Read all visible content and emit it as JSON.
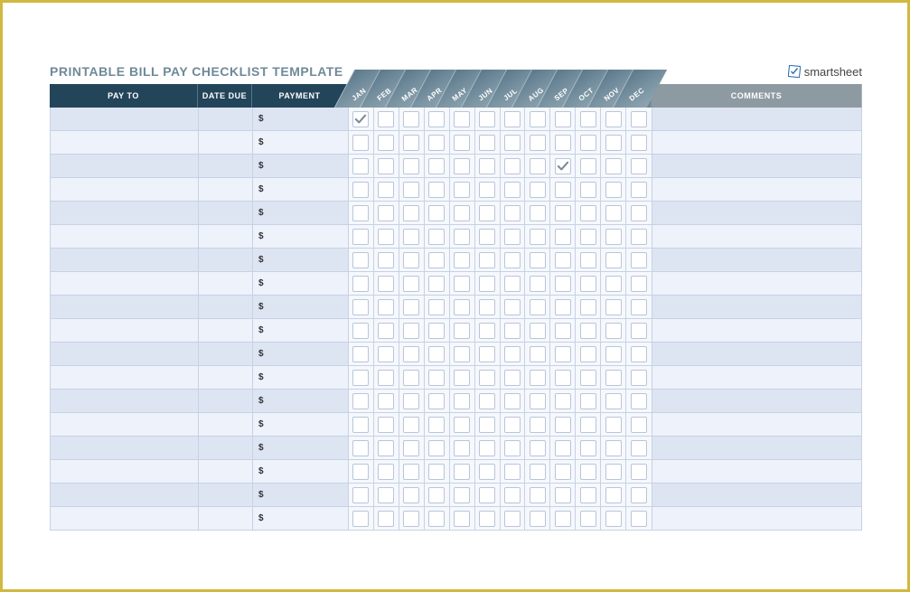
{
  "title": "PRINTABLE BILL PAY CHECKLIST TEMPLATE",
  "brand": "smartsheet",
  "headers": {
    "pay_to": "PAY TO",
    "date_due": "DATE DUE",
    "payment": "PAYMENT",
    "comments": "COMMENTS"
  },
  "months": [
    "JAN",
    "FEB",
    "MAR",
    "APR",
    "MAY",
    "JUN",
    "JUL",
    "AUG",
    "SEP",
    "OCT",
    "NOV",
    "DEC"
  ],
  "currency_symbol": "$",
  "rows": [
    {
      "pay_to": "",
      "date_due": "",
      "payment": "",
      "comments": "",
      "checks": [
        true,
        false,
        false,
        false,
        false,
        false,
        false,
        false,
        false,
        false,
        false,
        false
      ]
    },
    {
      "pay_to": "",
      "date_due": "",
      "payment": "",
      "comments": "",
      "checks": [
        false,
        false,
        false,
        false,
        false,
        false,
        false,
        false,
        false,
        false,
        false,
        false
      ]
    },
    {
      "pay_to": "",
      "date_due": "",
      "payment": "",
      "comments": "",
      "checks": [
        false,
        false,
        false,
        false,
        false,
        false,
        false,
        false,
        true,
        false,
        false,
        false
      ]
    },
    {
      "pay_to": "",
      "date_due": "",
      "payment": "",
      "comments": "",
      "checks": [
        false,
        false,
        false,
        false,
        false,
        false,
        false,
        false,
        false,
        false,
        false,
        false
      ]
    },
    {
      "pay_to": "",
      "date_due": "",
      "payment": "",
      "comments": "",
      "checks": [
        false,
        false,
        false,
        false,
        false,
        false,
        false,
        false,
        false,
        false,
        false,
        false
      ]
    },
    {
      "pay_to": "",
      "date_due": "",
      "payment": "",
      "comments": "",
      "checks": [
        false,
        false,
        false,
        false,
        false,
        false,
        false,
        false,
        false,
        false,
        false,
        false
      ]
    },
    {
      "pay_to": "",
      "date_due": "",
      "payment": "",
      "comments": "",
      "checks": [
        false,
        false,
        false,
        false,
        false,
        false,
        false,
        false,
        false,
        false,
        false,
        false
      ]
    },
    {
      "pay_to": "",
      "date_due": "",
      "payment": "",
      "comments": "",
      "checks": [
        false,
        false,
        false,
        false,
        false,
        false,
        false,
        false,
        false,
        false,
        false,
        false
      ]
    },
    {
      "pay_to": "",
      "date_due": "",
      "payment": "",
      "comments": "",
      "checks": [
        false,
        false,
        false,
        false,
        false,
        false,
        false,
        false,
        false,
        false,
        false,
        false
      ]
    },
    {
      "pay_to": "",
      "date_due": "",
      "payment": "",
      "comments": "",
      "checks": [
        false,
        false,
        false,
        false,
        false,
        false,
        false,
        false,
        false,
        false,
        false,
        false
      ]
    },
    {
      "pay_to": "",
      "date_due": "",
      "payment": "",
      "comments": "",
      "checks": [
        false,
        false,
        false,
        false,
        false,
        false,
        false,
        false,
        false,
        false,
        false,
        false
      ]
    },
    {
      "pay_to": "",
      "date_due": "",
      "payment": "",
      "comments": "",
      "checks": [
        false,
        false,
        false,
        false,
        false,
        false,
        false,
        false,
        false,
        false,
        false,
        false
      ]
    },
    {
      "pay_to": "",
      "date_due": "",
      "payment": "",
      "comments": "",
      "checks": [
        false,
        false,
        false,
        false,
        false,
        false,
        false,
        false,
        false,
        false,
        false,
        false
      ]
    },
    {
      "pay_to": "",
      "date_due": "",
      "payment": "",
      "comments": "",
      "checks": [
        false,
        false,
        false,
        false,
        false,
        false,
        false,
        false,
        false,
        false,
        false,
        false
      ]
    },
    {
      "pay_to": "",
      "date_due": "",
      "payment": "",
      "comments": "",
      "checks": [
        false,
        false,
        false,
        false,
        false,
        false,
        false,
        false,
        false,
        false,
        false,
        false
      ]
    },
    {
      "pay_to": "",
      "date_due": "",
      "payment": "",
      "comments": "",
      "checks": [
        false,
        false,
        false,
        false,
        false,
        false,
        false,
        false,
        false,
        false,
        false,
        false
      ]
    },
    {
      "pay_to": "",
      "date_due": "",
      "payment": "",
      "comments": "",
      "checks": [
        false,
        false,
        false,
        false,
        false,
        false,
        false,
        false,
        false,
        false,
        false,
        false
      ]
    },
    {
      "pay_to": "",
      "date_due": "",
      "payment": "",
      "comments": "",
      "checks": [
        false,
        false,
        false,
        false,
        false,
        false,
        false,
        false,
        false,
        false,
        false,
        false
      ]
    }
  ]
}
